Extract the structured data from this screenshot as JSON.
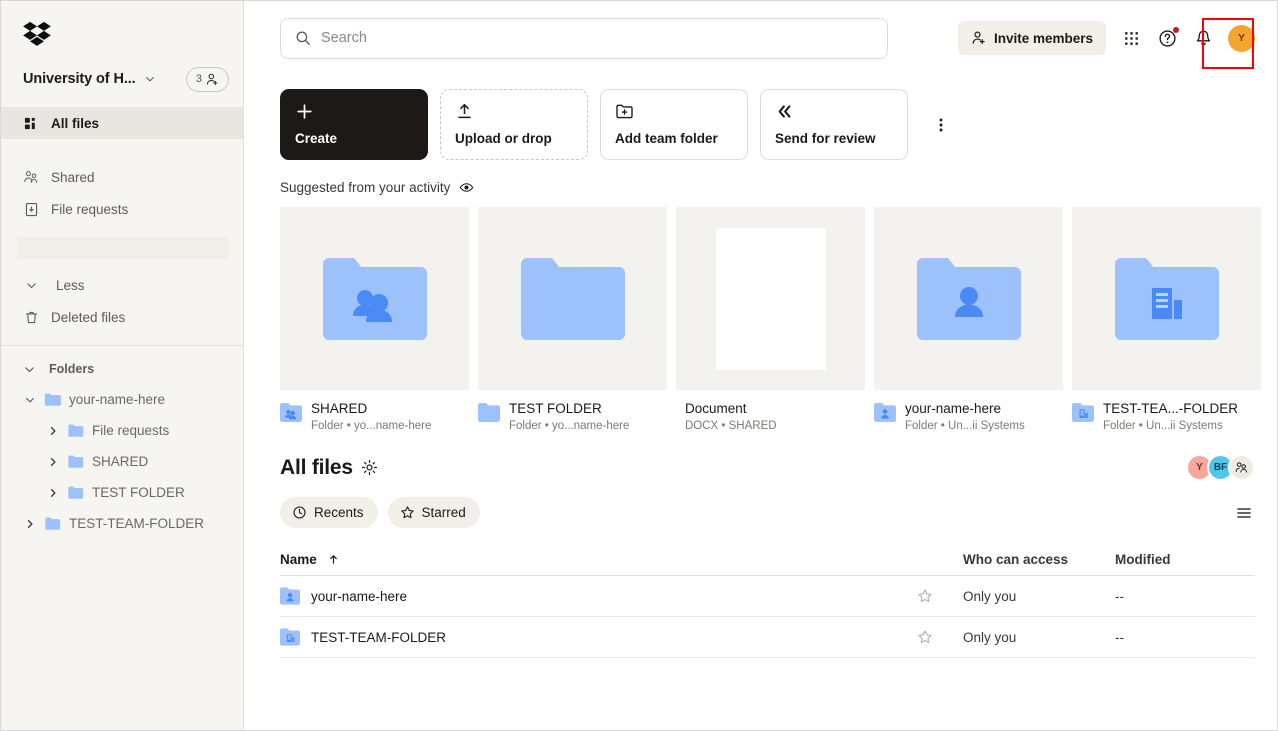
{
  "sidebar": {
    "logo_icon": "dropbox-logo",
    "team": {
      "name": "University of H...",
      "chevron_icon": "chevron-down-icon",
      "member_count": "3",
      "member_icon": "add-person-icon"
    },
    "nav": [
      {
        "label": "All files",
        "icon": "all-files-icon",
        "active": true
      },
      {
        "label": "Shared",
        "icon": "shared-people-icon",
        "active": false
      },
      {
        "label": "File requests",
        "icon": "file-request-icon",
        "active": false
      }
    ],
    "less_label": "Less",
    "less_icon": "chevron-down-icon",
    "deleted": {
      "label": "Deleted files",
      "icon": "trash-icon"
    },
    "folders_section": {
      "label": "Folders",
      "chevron_icon": "chevron-down-icon",
      "tree": [
        {
          "label": "your-name-here",
          "level": 1,
          "twisty": "chevron-down-icon",
          "icon": "folder-open-icon"
        },
        {
          "label": "File requests",
          "level": 2,
          "twisty": "chevron-right-icon",
          "icon": "folder-icon"
        },
        {
          "label": "SHARED",
          "level": 2,
          "twisty": "chevron-right-icon",
          "icon": "folder-icon"
        },
        {
          "label": "TEST FOLDER",
          "level": 2,
          "twisty": "chevron-right-icon",
          "icon": "folder-icon"
        },
        {
          "label": "TEST-TEAM-FOLDER",
          "level": 1,
          "twisty": "chevron-right-icon",
          "icon": "folder-icon"
        }
      ]
    }
  },
  "topbar": {
    "search": {
      "placeholder": "Search",
      "value": "",
      "icon": "search-icon"
    },
    "invite": {
      "label": "Invite members",
      "icon": "invite-person-icon"
    },
    "grid_icon": "apps-grid-icon",
    "help_icon": "help-circle-icon",
    "bell_icon": "notification-bell-icon",
    "avatar": {
      "initial": "Y",
      "color": "#f4a52c"
    },
    "highlight_color": "#ff0000"
  },
  "actions": {
    "buttons": [
      {
        "label": "Create",
        "icon": "plus-icon",
        "style": "primary"
      },
      {
        "label": "Upload or drop",
        "icon": "upload-arrow-icon",
        "style": "dashed"
      },
      {
        "label": "Add team folder",
        "icon": "folder-plus-icon",
        "style": "outline"
      },
      {
        "label": "Send for review",
        "icon": "send-review-icon",
        "style": "outline"
      }
    ],
    "overflow_icon": "kebab-menu-icon"
  },
  "suggested": {
    "title": "Suggested from your activity",
    "eye_icon": "eye-icon",
    "cards": [
      {
        "name": "SHARED",
        "sub": "Folder • yo...name-here",
        "thumb": "folder-shared",
        "mini_icon": "folder-shared-icon"
      },
      {
        "name": "TEST FOLDER",
        "sub": "Folder • yo...name-here",
        "thumb": "folder-plain",
        "mini_icon": "folder-plain-icon"
      },
      {
        "name": "Document",
        "sub": "DOCX • SHARED",
        "thumb": "document-page",
        "mini_icon": "none"
      },
      {
        "name": "your-name-here",
        "sub": "Folder • Un...ii Systems",
        "thumb": "folder-person",
        "mini_icon": "folder-person-icon"
      },
      {
        "name": "TEST-TEA...-FOLDER",
        "sub": "Folder • Un...ii Systems",
        "thumb": "folder-team",
        "mini_icon": "folder-team-icon"
      }
    ]
  },
  "all_files": {
    "title": "All files",
    "gear_icon": "gear-icon",
    "avatars": [
      {
        "initial": "Y",
        "color": "#f4a79b"
      },
      {
        "initial": "BF",
        "color": "#52c7e8"
      },
      {
        "initial": "",
        "color": "#efebe3",
        "icon": "add-members-icon"
      }
    ],
    "chips": [
      {
        "label": "Recents",
        "icon": "clock-icon"
      },
      {
        "label": "Starred",
        "icon": "star-icon"
      }
    ],
    "view_toggle_icon": "list-view-icon",
    "columns": {
      "name": "Name",
      "sort_icon": "arrow-up-icon",
      "who_can_access": "Who can access",
      "modified": "Modified"
    },
    "rows": [
      {
        "name": "your-name-here",
        "icon": "folder-person-icon",
        "star": "star-outline-icon",
        "access": "Only you",
        "modified": "--"
      },
      {
        "name": "TEST-TEAM-FOLDER",
        "icon": "folder-team-icon",
        "star": "star-outline-icon",
        "access": "Only you",
        "modified": "--"
      }
    ]
  }
}
